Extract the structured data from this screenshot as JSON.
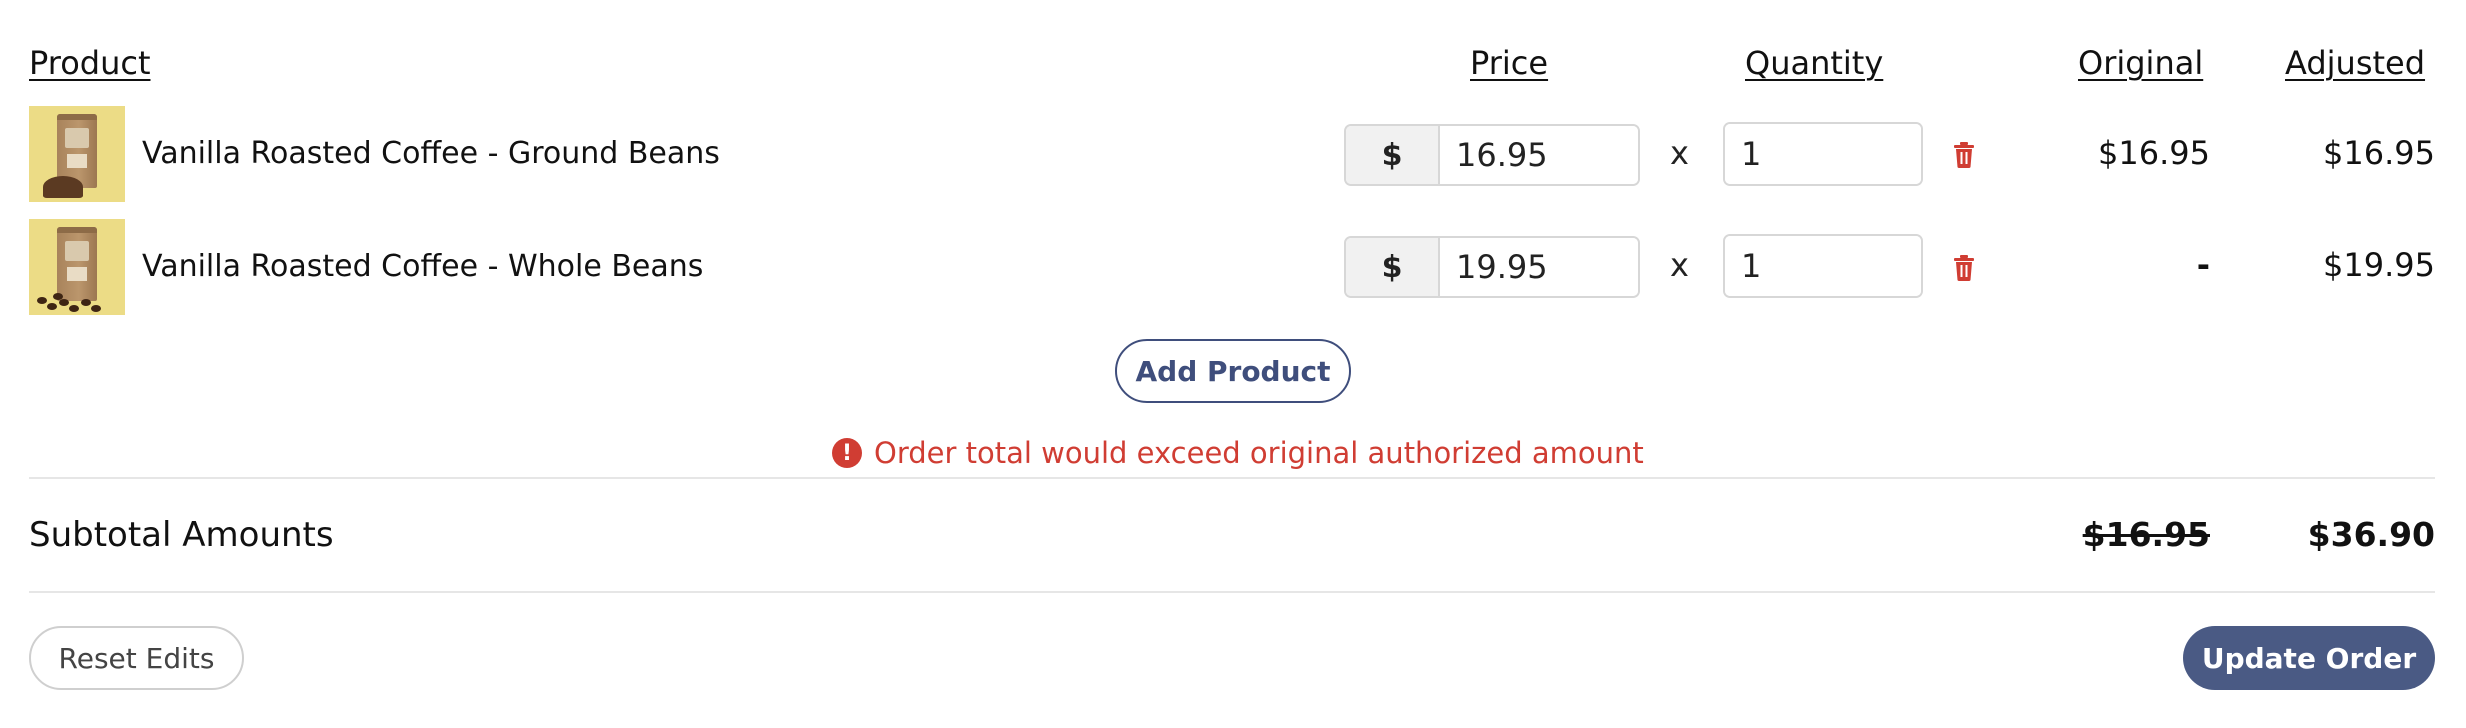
{
  "headers": {
    "product": "Product",
    "price": "Price",
    "quantity": "Quantity",
    "original": "Original",
    "adjusted": "Adjusted"
  },
  "rows": [
    {
      "name": "Vanilla Roasted Coffee - Ground Beans",
      "currency": "$",
      "price": "16.95",
      "times": "x",
      "quantity": "1",
      "original": "$16.95",
      "adjusted": "$16.95",
      "thumb_icon": "coffee-bag-ground-icon"
    },
    {
      "name": "Vanilla Roasted Coffee - Whole Beans",
      "currency": "$",
      "price": "19.95",
      "times": "x",
      "quantity": "1",
      "original": "-",
      "adjusted": "$19.95",
      "thumb_icon": "coffee-bag-beans-icon"
    }
  ],
  "add_product_label": "Add Product",
  "error": {
    "icon": "exclamation-circle-icon",
    "message": "Order total would exceed original authorized amount",
    "color": "#d03d33"
  },
  "subtotal": {
    "label": "Subtotal Amounts",
    "original": "$16.95",
    "adjusted": "$36.90"
  },
  "actions": {
    "reset_label": "Reset Edits",
    "update_label": "Update Order"
  },
  "colors": {
    "primary": "#4a5a84",
    "accent_outline": "#3f4e7c",
    "danger": "#d03d33",
    "thumb_background": "#ecdc86"
  }
}
